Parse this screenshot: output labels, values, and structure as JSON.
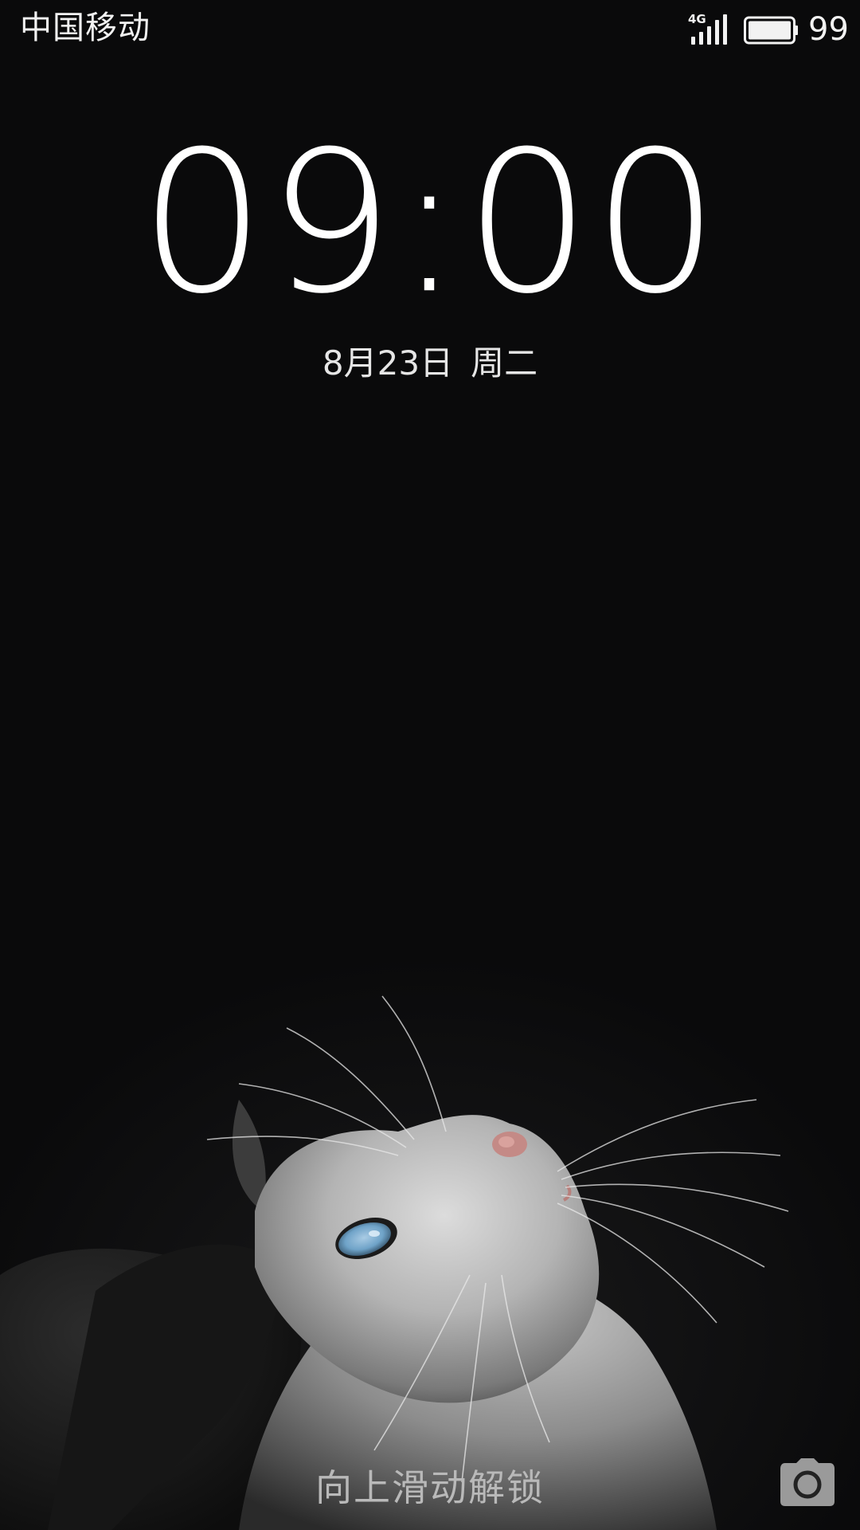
{
  "status_bar": {
    "carrier": "中国移动",
    "network_type": "4G",
    "signal_icon": "cellular-signal-icon",
    "battery_icon": "battery-icon",
    "battery_level": "99"
  },
  "lockscreen": {
    "time": "09:00",
    "date": "8月23日",
    "weekday": "周二",
    "unlock_hint": "向上滑动解锁",
    "camera_icon": "camera-icon"
  },
  "wallpaper": {
    "subject": "cat-wallpaper",
    "eye_color": "#6fa3c8"
  }
}
